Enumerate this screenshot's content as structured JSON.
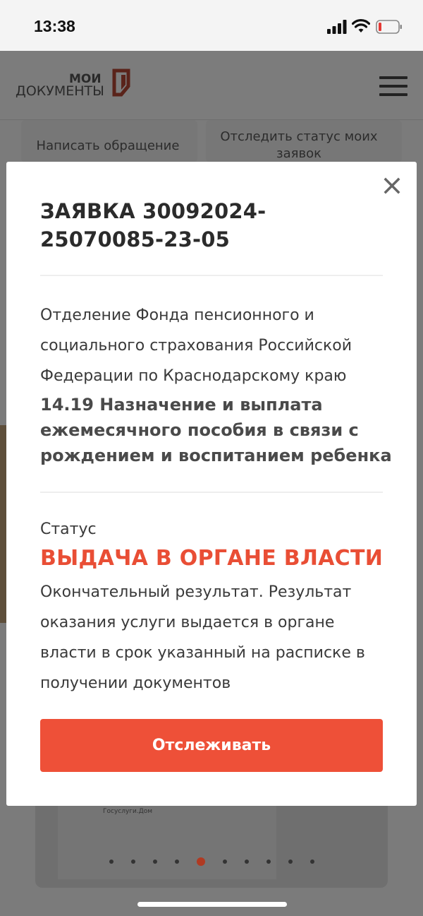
{
  "statusbar": {
    "time": "13:38",
    "icons": [
      "cellular-signal-icon",
      "wifi-icon",
      "battery-low-icon"
    ]
  },
  "header": {
    "logo_top": "МОИ",
    "logo_bottom": "ДОКУМЕНТЫ",
    "menu_icon": "hamburger-menu-icon"
  },
  "background": {
    "tile_write": "Написать обращение",
    "tile_track": "Отследить статус моих заявок",
    "banner_caption": "Госуслуги.Дом",
    "carousel_dots": 10,
    "carousel_active_index": 4
  },
  "modal": {
    "title": "ЗАЯВКА 30092024-25070085-23-05",
    "organization": "Отделение Фонда пенсионного и социального страхования Российской Федерации по Краснодарскому краю",
    "service": "14.19 Назначение и выплата ежемесячного пособия в связи с рождением и воспитанием ребенка",
    "status_label": "Статус",
    "status_value": "ВЫДАЧА В ОРГАНЕ ВЛАСТИ",
    "status_description": "Окончательный результат. Результат оказания услуги выдается в органе власти в срок указанный на расписке в получении документов",
    "track_button": "Отслеживать",
    "close_icon": "close-icon"
  },
  "colors": {
    "accent": "#ee5038",
    "status_text": "#e94e35",
    "overlay": "#7b7b7b"
  }
}
